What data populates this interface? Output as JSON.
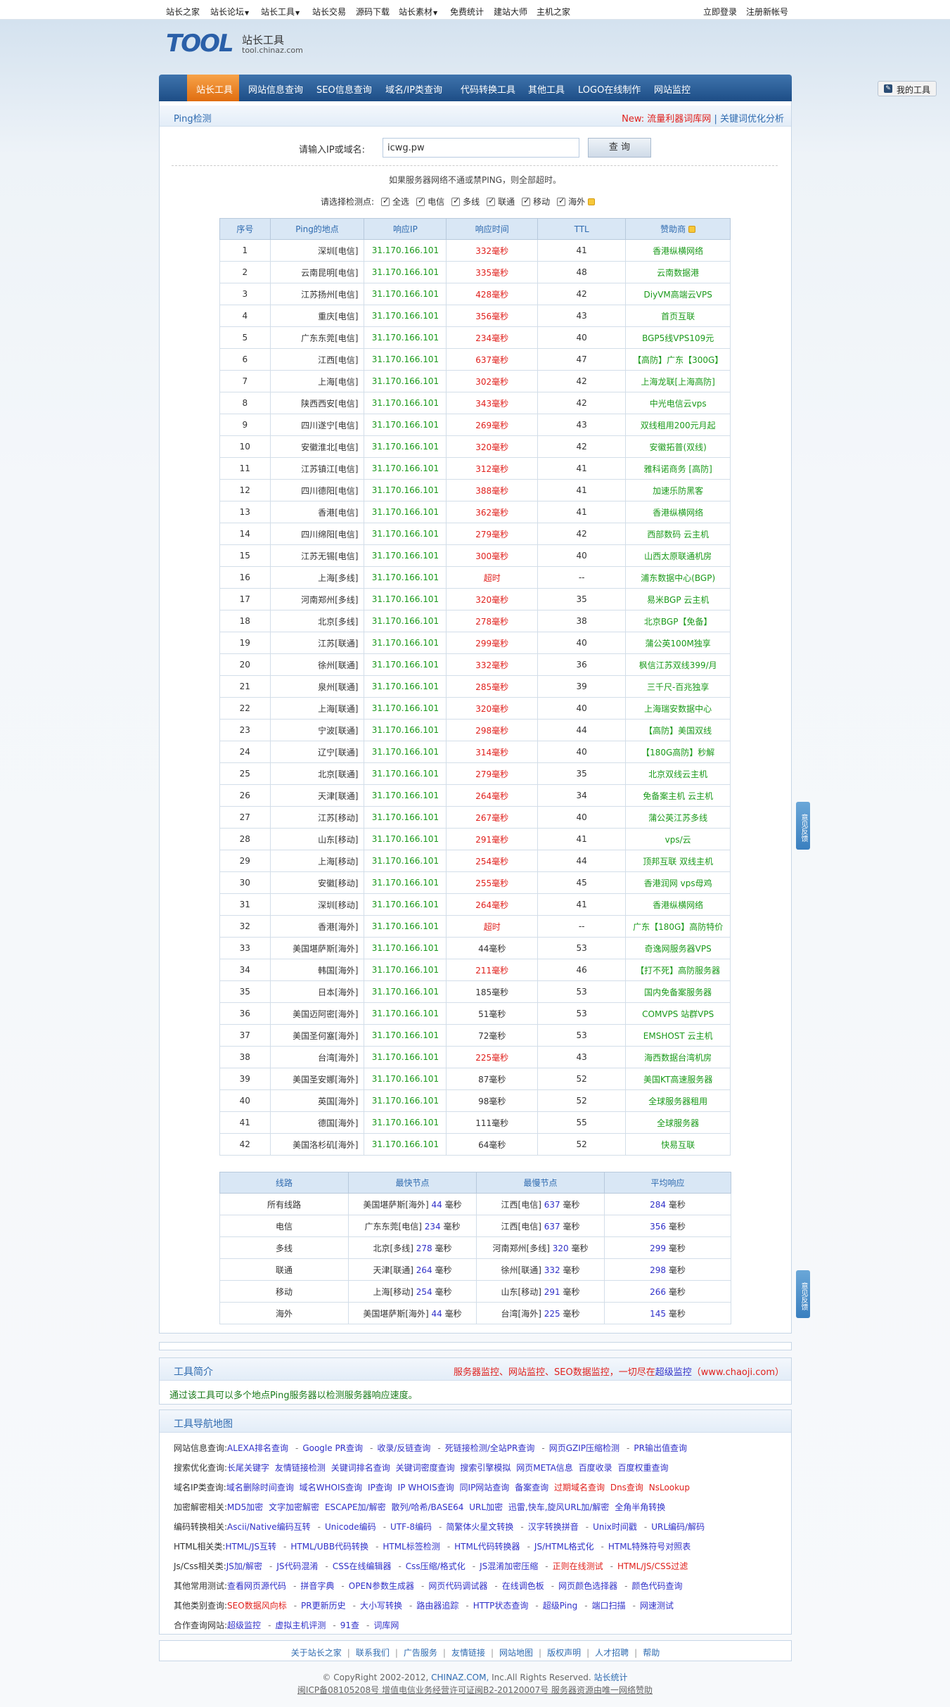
{
  "topbar": {
    "left": [
      "站长之家",
      "站长论坛",
      "站长工具",
      "站长交易",
      "源码下载",
      "站长素材",
      "免费统计",
      "建站大师",
      "主机之家"
    ],
    "dropdowns": [
      false,
      true,
      true,
      false,
      false,
      true,
      false,
      false,
      false
    ],
    "login": "立即登录",
    "register": "注册新帐号"
  },
  "logo": {
    "mark": "TOOL",
    "cn": "站长工具",
    "domain": "tool.chinaz.com"
  },
  "nav": {
    "active": "站长工具",
    "items": [
      "网站信息查询",
      "SEO信息查询",
      "域名/IP类查询",
      "代码转换工具",
      "其他工具",
      "LOGO在线制作",
      "网站监控"
    ],
    "my_tools": "我的工具"
  },
  "panel": {
    "title": "Ping检测",
    "new_label": "New:",
    "new_link1": "流量利器词库网",
    "sep": "|",
    "new_link2": "关键词优化分析"
  },
  "search": {
    "label": "请输入IP或域名:",
    "value": "icwg.pw",
    "button": "查 询"
  },
  "hint": "如果服务器网络不通或禁PING，则全部超时。",
  "options": {
    "label": "请选择检测点:",
    "items": [
      "全选",
      "电信",
      "多线",
      "联通",
      "移动",
      "海外"
    ]
  },
  "ping_table": {
    "headers": [
      "序号",
      "Ping的地点",
      "响应IP",
      "响应时间",
      "TTL",
      "赞助商"
    ],
    "rows": [
      [
        "1",
        "深圳[电信]",
        "31.170.166.101",
        "332毫秒",
        "41",
        "香港纵横网络"
      ],
      [
        "2",
        "云南昆明[电信]",
        "31.170.166.101",
        "335毫秒",
        "48",
        "云南数据港"
      ],
      [
        "3",
        "江苏扬州[电信]",
        "31.170.166.101",
        "428毫秒",
        "42",
        "DiyVM高端云VPS"
      ],
      [
        "4",
        "重庆[电信]",
        "31.170.166.101",
        "356毫秒",
        "43",
        "首页互联"
      ],
      [
        "5",
        "广东东莞[电信]",
        "31.170.166.101",
        "234毫秒",
        "40",
        "BGP5线VPS109元"
      ],
      [
        "6",
        "江西[电信]",
        "31.170.166.101",
        "637毫秒",
        "47",
        "【高防】广东【300G】"
      ],
      [
        "7",
        "上海[电信]",
        "31.170.166.101",
        "302毫秒",
        "42",
        "上海龙联[上海高防]"
      ],
      [
        "8",
        "陕西西安[电信]",
        "31.170.166.101",
        "343毫秒",
        "42",
        "中光电信云vps"
      ],
      [
        "9",
        "四川遂宁[电信]",
        "31.170.166.101",
        "269毫秒",
        "43",
        "双线租用200元月起"
      ],
      [
        "10",
        "安徽淮北[电信]",
        "31.170.166.101",
        "320毫秒",
        "42",
        "安徽拓普(双线)"
      ],
      [
        "11",
        "江苏镇江[电信]",
        "31.170.166.101",
        "312毫秒",
        "41",
        "雅科诺商务 [高防]"
      ],
      [
        "12",
        "四川德阳[电信]",
        "31.170.166.101",
        "388毫秒",
        "41",
        "加速乐防黑客"
      ],
      [
        "13",
        "香港[电信]",
        "31.170.166.101",
        "362毫秒",
        "41",
        "香港纵横网络"
      ],
      [
        "14",
        "四川绵阳[电信]",
        "31.170.166.101",
        "279毫秒",
        "42",
        "西部数码 云主机"
      ],
      [
        "15",
        "江苏无锡[电信]",
        "31.170.166.101",
        "300毫秒",
        "40",
        "山西太原联通机房"
      ],
      [
        "16",
        "上海[多线]",
        "31.170.166.101",
        "超时",
        "--",
        "浦东数据中心(BGP)"
      ],
      [
        "17",
        "河南郑州[多线]",
        "31.170.166.101",
        "320毫秒",
        "35",
        "易米BGP 云主机"
      ],
      [
        "18",
        "北京[多线]",
        "31.170.166.101",
        "278毫秒",
        "38",
        "北京BGP【免备】"
      ],
      [
        "19",
        "江苏[联通]",
        "31.170.166.101",
        "299毫秒",
        "40",
        "蒲公英100M独享"
      ],
      [
        "20",
        "徐州[联通]",
        "31.170.166.101",
        "332毫秒",
        "36",
        "枫信江苏双线399/月"
      ],
      [
        "21",
        "泉州[联通]",
        "31.170.166.101",
        "285毫秒",
        "39",
        "三千尺-百兆独享"
      ],
      [
        "22",
        "上海[联通]",
        "31.170.166.101",
        "320毫秒",
        "40",
        "上海瑞安数据中心"
      ],
      [
        "23",
        "宁波[联通]",
        "31.170.166.101",
        "298毫秒",
        "44",
        "【高防】美国双线"
      ],
      [
        "24",
        "辽宁[联通]",
        "31.170.166.101",
        "314毫秒",
        "40",
        "【180G高防】秒解"
      ],
      [
        "25",
        "北京[联通]",
        "31.170.166.101",
        "279毫秒",
        "35",
        "北京双线云主机"
      ],
      [
        "26",
        "天津[联通]",
        "31.170.166.101",
        "264毫秒",
        "34",
        "免备案主机 云主机"
      ],
      [
        "27",
        "江苏[移动]",
        "31.170.166.101",
        "267毫秒",
        "40",
        "蒲公英江苏多线"
      ],
      [
        "28",
        "山东[移动]",
        "31.170.166.101",
        "291毫秒",
        "41",
        "vps/云"
      ],
      [
        "29",
        "上海[移动]",
        "31.170.166.101",
        "254毫秒",
        "44",
        "顶邦互联 双线主机"
      ],
      [
        "30",
        "安徽[移动]",
        "31.170.166.101",
        "255毫秒",
        "45",
        "香港润网 vps母鸡"
      ],
      [
        "31",
        "深圳[移动]",
        "31.170.166.101",
        "264毫秒",
        "41",
        "香港纵横网络"
      ],
      [
        "32",
        "香港[海外]",
        "31.170.166.101",
        "超时",
        "--",
        "广东【180G】高防特价"
      ],
      [
        "33",
        "美国堪萨斯[海外]",
        "31.170.166.101",
        "44毫秒",
        "53",
        "奇逸网服务器VPS"
      ],
      [
        "34",
        "韩国[海外]",
        "31.170.166.101",
        "211毫秒",
        "46",
        "【打不死】高防服务器"
      ],
      [
        "35",
        "日本[海外]",
        "31.170.166.101",
        "185毫秒",
        "53",
        "国内免备案服务器"
      ],
      [
        "36",
        "美国迈阿密[海外]",
        "31.170.166.101",
        "51毫秒",
        "53",
        "COMVPS 站群VPS"
      ],
      [
        "37",
        "美国圣何塞[海外]",
        "31.170.166.101",
        "72毫秒",
        "53",
        "EMSHOST 云主机"
      ],
      [
        "38",
        "台湾[海外]",
        "31.170.166.101",
        "225毫秒",
        "43",
        "海西数据台湾机房"
      ],
      [
        "39",
        "美国圣安娜[海外]",
        "31.170.166.101",
        "87毫秒",
        "52",
        "美国KT高速服务器"
      ],
      [
        "40",
        "英国[海外]",
        "31.170.166.101",
        "98毫秒",
        "52",
        "全球服务器租用"
      ],
      [
        "41",
        "德国[海外]",
        "31.170.166.101",
        "111毫秒",
        "55",
        "全球服务器"
      ],
      [
        "42",
        "美国洛杉矶[海外]",
        "31.170.166.101",
        "64毫秒",
        "52",
        "快易互联"
      ]
    ]
  },
  "summary_table": {
    "headers": [
      "线路",
      "最快节点",
      "最慢节点",
      "平均响应"
    ],
    "unit": "毫秒",
    "rows": [
      [
        "所有线路",
        "美国堪萨斯[海外]",
        "44",
        "江西[电信]",
        "637",
        "284"
      ],
      [
        "电信",
        "广东东莞[电信]",
        "234",
        "江西[电信]",
        "637",
        "356"
      ],
      [
        "多线",
        "北京[多线]",
        "278",
        "河南郑州[多线]",
        "320",
        "299"
      ],
      [
        "联通",
        "天津[联通]",
        "264",
        "徐州[联通]",
        "332",
        "298"
      ],
      [
        "移动",
        "上海[移动]",
        "254",
        "山东[移动]",
        "291",
        "266"
      ],
      [
        "海外",
        "美国堪萨斯[海外]",
        "44",
        "台湾[海外]",
        "225",
        "145"
      ]
    ]
  },
  "intro": {
    "title": "工具简介",
    "promo_red": "服务器监控、网站监控、SEO数据监控，一切尽在",
    "promo_link": "超级监控",
    "promo_url": "（www.chaoji.com）",
    "body": "通过该工具可以多个地点Ping服务器以检测服务器响应速度。"
  },
  "toolmap": {
    "title": "工具导航地图",
    "rows": [
      {
        "label": "网站信息查询:",
        "links": [
          "ALEXA排名查询",
          "Google PR查询",
          "收录/反链查询",
          "死链接检测/全站PR查询",
          "网页GZIP压缩检测",
          "PR输出值查询"
        ],
        "sep": true,
        "red": []
      },
      {
        "label": "搜索优化查询:",
        "links": [
          "长尾关键字",
          "友情链接检测",
          "关键词排名查询",
          "关键词密度查询",
          "搜索引擎模拟",
          "网页META信息",
          "百度收录",
          "百度权重查询"
        ],
        "sep": false,
        "red": []
      },
      {
        "label": "域名IP类查询:",
        "links": [
          "域名删除时间查询",
          "域名WHOIS查询",
          "IP查询",
          "IP WHOIS查询",
          "同IP网站查询",
          "备案查询",
          "过期域名查询",
          "Dns查询",
          "NsLookup"
        ],
        "sep": false,
        "red": [
          6,
          7,
          8
        ]
      },
      {
        "label": "加密解密相关:",
        "links": [
          "MD5加密",
          "文字加密解密",
          "ESCAPE加/解密",
          "散列/哈希/BASE64",
          "URL加密",
          "迅雷,快车,旋风URL加/解密",
          "全角半角转换"
        ],
        "sep": false,
        "red": []
      },
      {
        "label": "编码转换相关:",
        "links": [
          "Ascii/Native编码互转",
          "Unicode编码",
          "UTF-8编码",
          "简繁体火星文转换",
          "汉字转换拼音",
          "Unix时间戳",
          "URL编码/解码"
        ],
        "sep": true,
        "red": []
      },
      {
        "label": "HTML相关类:",
        "links": [
          "HTML/JS互转",
          "HTML/UBB代码转换",
          "HTML标签检测",
          "HTML代码转换器",
          "JS/HTML格式化",
          "HTML特殊符号对照表"
        ],
        "sep": true,
        "red": []
      },
      {
        "label": "Js/Css相关类:",
        "links": [
          "JS加/解密",
          "JS代码混淆",
          "CSS在线编辑器",
          "Css压缩/格式化",
          "JS混淆加密压缩",
          "正则在线测试",
          "HTML/JS/CSS过滤"
        ],
        "sep": true,
        "red": [
          5,
          6
        ]
      },
      {
        "label": "其他常用测试:",
        "links": [
          "查看网页源代码",
          "拼音字典",
          "OPEN参数生成器",
          "网页代码调试器",
          "在线调色板",
          "网页颜色选择器",
          "颜色代码查询"
        ],
        "sep": true,
        "red": []
      },
      {
        "label": "其他类别查询:",
        "links": [
          "SEO数据风向标",
          "PR更新历史",
          "大小写转换",
          "路由器追踪",
          "HTTP状态查询",
          "超级Ping",
          "端口扫描",
          "网速测试"
        ],
        "sep": true,
        "red": [
          0
        ]
      },
      {
        "label": "合作查询网站:",
        "links": [
          "超级监控",
          "虚拟主机评测",
          "91查",
          "词库网"
        ],
        "sep": true,
        "red": []
      }
    ]
  },
  "footer": {
    "links": [
      "关于站长之家",
      "联系我们",
      "广告服务",
      "友情链接",
      "网站地图",
      "版权声明",
      "人才招聘",
      "帮助"
    ],
    "copyright_pre": "© CopyRight 2002-2012,",
    "copyright_link": "CHINAZ.COM,",
    "copyright_post": "Inc.All Rights Reserved.",
    "stats": "站长统计",
    "icp": "闽ICP备08105208号  增值电信业务经营许可证闽B2-20120007号  服务器资源由唯一网络赞助"
  },
  "float_buttons": [
    "意见反馈",
    "意见反馈"
  ],
  "colors": {
    "nav": "#1d4d86",
    "active_tab": "#e06d10",
    "ip_green": "#1a9a1a",
    "ms_red": "#e0201c",
    "link_blue": "#2f6bb0"
  }
}
